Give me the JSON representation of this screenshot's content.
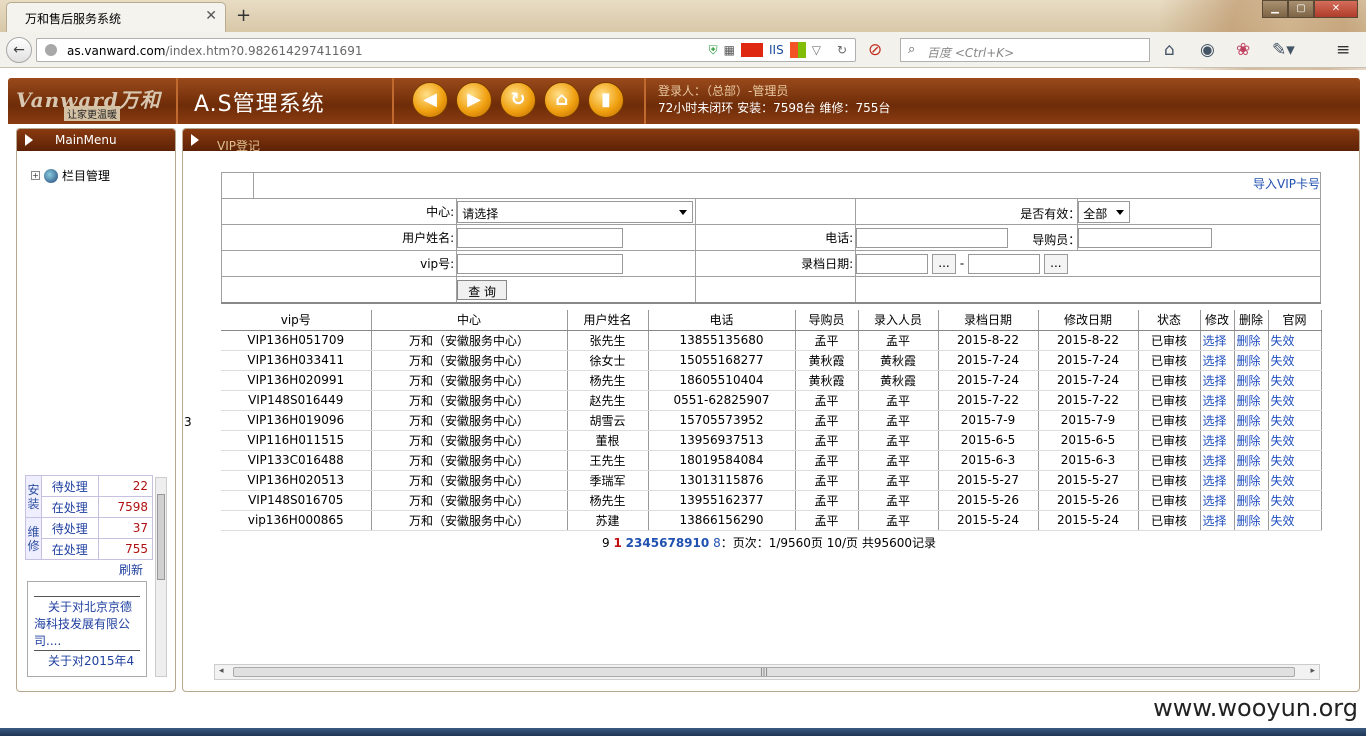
{
  "browser": {
    "tab_title": "万和售后服务系统",
    "tab_close": "✕",
    "new_tab": "+",
    "url_domain": "as.vanward.com",
    "url_path": "/index.htm?0.982614297411691",
    "url_icon_text": "IIS",
    "search_placeholder": "百度 <Ctrl+K>"
  },
  "header": {
    "brand": "Vanward万和",
    "slogan": "让家更温暖",
    "app_title": "A.S管理系统",
    "login_line": "登录人：（总部）-管理员",
    "stats_line": "72小时未闭环 安装：7598台 维修：755台"
  },
  "sidebar": {
    "title": "MainMenu",
    "tree_item": "栏目管理",
    "stats": [
      {
        "cat": "安装",
        "rows": [
          {
            "label": "待处理",
            "value": "22"
          },
          {
            "label": "在处理",
            "value": "7598"
          }
        ]
      },
      {
        "cat": "维修",
        "rows": [
          {
            "label": "待处理",
            "value": "37"
          },
          {
            "label": "在处理",
            "value": "755"
          }
        ]
      }
    ],
    "refresh": "刷新",
    "news": [
      "关于对北京京德海科技发展有限公司....",
      "关于对2015年4"
    ]
  },
  "main": {
    "title": "VIP登记",
    "page_num": "3",
    "import_link": "导入VIP卡号",
    "filters": {
      "center_label": "中心:",
      "center_value": "请选择",
      "valid_label": "是否有效：",
      "valid_value": "全部",
      "name_label": "用户姓名:",
      "phone_label": "电话:",
      "guide_label": "导购员：",
      "vip_label": "vip号:",
      "date_label": "录档日期:",
      "date_btn": "...",
      "date_sep": "-",
      "query_btn": "查 询"
    },
    "columns": [
      "vip号",
      "中心",
      "用户姓名",
      "电话",
      "导购员",
      "录入人员",
      "录档日期",
      "修改日期",
      "状态",
      "修改",
      "删除",
      "官网"
    ],
    "rows": [
      [
        "VIP136H051709",
        "万和（安徽服务中心）",
        "张先生",
        "13855135680",
        "孟平",
        "孟平",
        "2015-8-22",
        "2015-8-22",
        "已审核",
        "选择",
        "删除",
        "失效"
      ],
      [
        "VIP136H033411",
        "万和（安徽服务中心）",
        "徐女士",
        "15055168277",
        "黄秋霞",
        "黄秋霞",
        "2015-7-24",
        "2015-7-24",
        "已审核",
        "选择",
        "删除",
        "失效"
      ],
      [
        "VIP136H020991",
        "万和（安徽服务中心）",
        "杨先生",
        "18605510404",
        "黄秋霞",
        "黄秋霞",
        "2015-7-24",
        "2015-7-24",
        "已审核",
        "选择",
        "删除",
        "失效"
      ],
      [
        "VIP148S016449",
        "万和（安徽服务中心）",
        "赵先生",
        "0551-62825907",
        "孟平",
        "孟平",
        "2015-7-22",
        "2015-7-22",
        "已审核",
        "选择",
        "删除",
        "失效"
      ],
      [
        "VIP136H019096",
        "万和（安徽服务中心）",
        "胡雪云",
        "15705573952",
        "孟平",
        "孟平",
        "2015-7-9",
        "2015-7-9",
        "已审核",
        "选择",
        "删除",
        "失效"
      ],
      [
        "VIP116H011515",
        "万和（安徽服务中心）",
        "董根",
        "13956937513",
        "孟平",
        "孟平",
        "2015-6-5",
        "2015-6-5",
        "已审核",
        "选择",
        "删除",
        "失效"
      ],
      [
        "VIP133C016488",
        "万和（安徽服务中心）",
        "王先生",
        "18019584084",
        "孟平",
        "孟平",
        "2015-6-3",
        "2015-6-3",
        "已审核",
        "选择",
        "删除",
        "失效"
      ],
      [
        "VIP136H020513",
        "万和（安徽服务中心）",
        "季瑞军",
        "13013115876",
        "孟平",
        "孟平",
        "2015-5-27",
        "2015-5-27",
        "已审核",
        "选择",
        "删除",
        "失效"
      ],
      [
        "VIP148S016705",
        "万和（安徽服务中心）",
        "杨先生",
        "13955162377",
        "孟平",
        "孟平",
        "2015-5-26",
        "2015-5-26",
        "已审核",
        "选择",
        "删除",
        "失效"
      ],
      [
        "vip136H000865",
        "万和（安徽服务中心）",
        "苏建",
        "13866156290",
        "孟平",
        "孟平",
        "2015-5-24",
        "2015-5-24",
        "已审核",
        "选择",
        "删除",
        "失效"
      ]
    ],
    "pager": {
      "prefix": "9",
      "current": "1",
      "pages": [
        "2",
        "3",
        "4",
        "5",
        "6",
        "7",
        "8",
        "9",
        "10"
      ],
      "last": "8",
      "summary": "：页次：1/9560页 10/页 共95600记录"
    }
  },
  "watermark": "www.wooyun.org"
}
